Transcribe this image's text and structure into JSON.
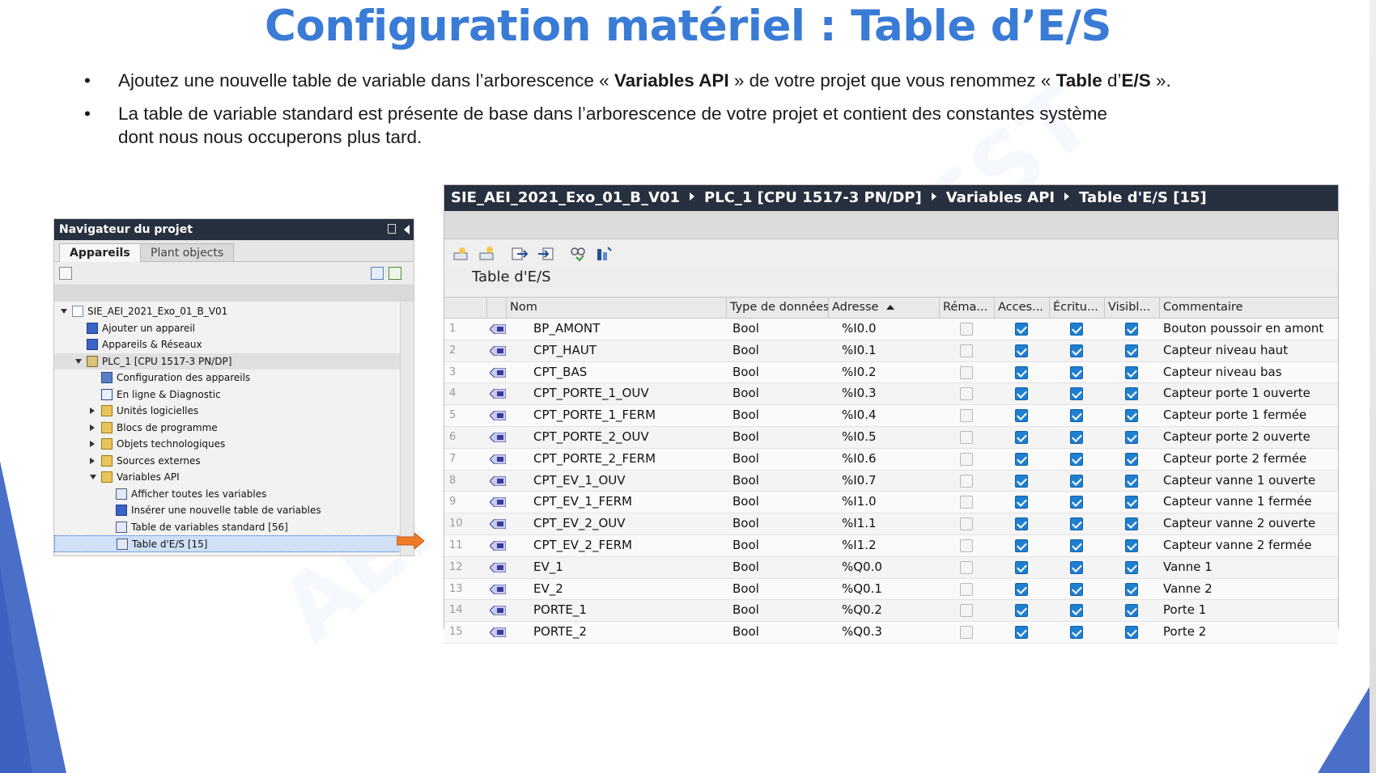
{
  "slide": {
    "title": "Configuration matériel : Table d’E/S",
    "bullet1": {
      "p1": "Ajoutez une nouvelle table de variable dans l’arborescence « ",
      "b1": "Variables API",
      "p2": " » de votre projet que vous renommez « ",
      "b2": "Table",
      "p3": " d’",
      "b3": "E/S",
      "p4": " »."
    },
    "bullet2": {
      "line1": "La table de variable standard est présente de base dans l’arborescence de votre projet et contient des constantes système",
      "line2": "dont nous nous occuperons plus tard."
    },
    "watermark1": "AEI",
    "watermark2": "EST"
  },
  "navigator": {
    "title": "Navigateur du projet",
    "tabs": [
      "Appareils",
      "Plant objects"
    ],
    "tree": [
      {
        "label": "SIE_AEI_2021_Exo_01_B_V01",
        "level": 0,
        "toggle": "open",
        "icon": "project-icon"
      },
      {
        "label": "Ajouter un appareil",
        "level": 1,
        "toggle": "none",
        "icon": "add-device-icon"
      },
      {
        "label": "Appareils & Réseaux",
        "level": 1,
        "toggle": "none",
        "icon": "network-icon"
      },
      {
        "label": "PLC_1 [CPU 1517-3 PN/DP]",
        "level": 1,
        "toggle": "open",
        "icon": "plc-icon"
      },
      {
        "label": "Configuration des appareils",
        "level": 2,
        "toggle": "none",
        "icon": "device-config-icon"
      },
      {
        "label": "En ligne & Diagnostic",
        "level": 2,
        "toggle": "none",
        "icon": "diagnostic-icon"
      },
      {
        "label": "Unités logicielles",
        "level": 2,
        "toggle": "closed",
        "icon": "folder-icon"
      },
      {
        "label": "Blocs de programme",
        "level": 2,
        "toggle": "closed",
        "icon": "folder-icon"
      },
      {
        "label": "Objets technologiques",
        "level": 2,
        "toggle": "closed",
        "icon": "folder-icon"
      },
      {
        "label": "Sources externes",
        "level": 2,
        "toggle": "closed",
        "icon": "folder-icon"
      },
      {
        "label": "Variables API",
        "level": 2,
        "toggle": "open",
        "icon": "folder-icon"
      },
      {
        "label": "Afficher toutes les variables",
        "level": 3,
        "toggle": "none",
        "icon": "tag-table-icon"
      },
      {
        "label": "Insérer une nouvelle table de variables",
        "level": 3,
        "toggle": "none",
        "icon": "add-tag-table-icon"
      },
      {
        "label": "Table de variables standard [56]",
        "level": 3,
        "toggle": "none",
        "icon": "tag-table-icon"
      },
      {
        "label": "Table d'E/S [15]",
        "level": 3,
        "toggle": "none",
        "icon": "tag-table-icon",
        "selected": true
      }
    ]
  },
  "panel": {
    "breadcrumb": [
      "SIE_AEI_2021_Exo_01_B_V01",
      "PLC_1 [CPU 1517-3 PN/DP]",
      "Variables API",
      "Table d'E/S [15]"
    ],
    "table_title": "Table d'E/S",
    "columns": [
      "Nom",
      "Type de données",
      "Adresse",
      "Réma...",
      "Acces...",
      "Écritu...",
      "Visibl...",
      "Commentaire"
    ],
    "rows": [
      {
        "n": "1",
        "name": "BP_AMONT",
        "type": "Bool",
        "addr": "%I0.0",
        "comment": "Bouton poussoir en amont"
      },
      {
        "n": "2",
        "name": "CPT_HAUT",
        "type": "Bool",
        "addr": "%I0.1",
        "comment": "Capteur niveau haut"
      },
      {
        "n": "3",
        "name": "CPT_BAS",
        "type": "Bool",
        "addr": "%I0.2",
        "comment": "Capteur niveau bas"
      },
      {
        "n": "4",
        "name": "CPT_PORTE_1_OUV",
        "type": "Bool",
        "addr": "%I0.3",
        "comment": "Capteur porte 1 ouverte"
      },
      {
        "n": "5",
        "name": "CPT_PORTE_1_FERM",
        "type": "Bool",
        "addr": "%I0.4",
        "comment": "Capteur porte 1 fermée"
      },
      {
        "n": "6",
        "name": "CPT_PORTE_2_OUV",
        "type": "Bool",
        "addr": "%I0.5",
        "comment": "Capteur porte 2 ouverte"
      },
      {
        "n": "7",
        "name": "CPT_PORTE_2_FERM",
        "type": "Bool",
        "addr": "%I0.6",
        "comment": "Capteur porte 2 fermée"
      },
      {
        "n": "8",
        "name": "CPT_EV_1_OUV",
        "type": "Bool",
        "addr": "%I0.7",
        "comment": "Capteur vanne 1 ouverte"
      },
      {
        "n": "9",
        "name": "CPT_EV_1_FERM",
        "type": "Bool",
        "addr": "%I1.0",
        "comment": "Capteur vanne 1 fermée"
      },
      {
        "n": "10",
        "name": "CPT_EV_2_OUV",
        "type": "Bool",
        "addr": "%I1.1",
        "comment": "Capteur vanne 2 ouverte"
      },
      {
        "n": "11",
        "name": "CPT_EV_2_FERM",
        "type": "Bool",
        "addr": "%I1.2",
        "comment": "Capteur vanne 2 fermée"
      },
      {
        "n": "12",
        "name": "EV_1",
        "type": "Bool",
        "addr": "%Q0.0",
        "comment": "Vanne 1"
      },
      {
        "n": "13",
        "name": "EV_2",
        "type": "Bool",
        "addr": "%Q0.1",
        "comment": "Vanne 2"
      },
      {
        "n": "14",
        "name": "PORTE_1",
        "type": "Bool",
        "addr": "%Q0.2",
        "comment": "Porte 1"
      },
      {
        "n": "15",
        "name": "PORTE_2",
        "type": "Bool",
        "addr": "%Q0.3",
        "comment": "Porte 2"
      }
    ],
    "checkbox_states": {
      "retain": false,
      "accessible": true,
      "writable": true,
      "visible": true
    }
  },
  "colors": {
    "title": "#3a7bd5",
    "header_dark": "#27303f",
    "accent_blue": "#4a6fc9",
    "arrow_orange": "#f07c2a",
    "checkbox": "#1f7fd0"
  }
}
